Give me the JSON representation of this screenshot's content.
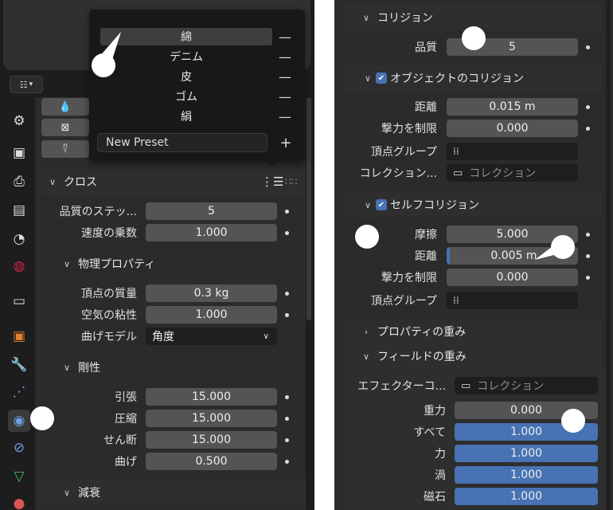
{
  "popup": {
    "presets": [
      "綿",
      "デニム",
      "皮",
      "ゴム",
      "絹"
    ],
    "remove_icon": "minus-icon",
    "new_preset_placeholder": "New Preset",
    "add_icon": "plus-icon"
  },
  "left": {
    "cloth_header": "クロス",
    "rows_top": [
      {
        "label": "品質のステッ...",
        "value": "5"
      },
      {
        "label": "速度の乗数",
        "value": "1.000"
      }
    ],
    "physics_header": "物理プロパティ",
    "physics_rows": [
      {
        "label": "頂点の質量",
        "value": "0.3 kg"
      },
      {
        "label": "空気の粘性",
        "value": "1.000"
      }
    ],
    "bend_model_label": "曲げモデル",
    "bend_model_value": "角度",
    "stiffness_header": "剛性",
    "stiffness_rows": [
      {
        "label": "引張",
        "value": "15.000"
      },
      {
        "label": "圧縮",
        "value": "15.000"
      },
      {
        "label": "せん断",
        "value": "15.000"
      },
      {
        "label": "曲げ",
        "value": "0.500"
      }
    ],
    "damping_header": "減衰"
  },
  "right": {
    "collision_header": "コリジョン",
    "quality_label": "品質",
    "quality_value": "5",
    "object_collision_header": "オブジェクトのコリジョン",
    "object_rows": [
      {
        "label": "距離",
        "value": "0.015 m"
      },
      {
        "label": "撃力を制限",
        "value": "0.000"
      }
    ],
    "vertex_group_label": "頂点グループ",
    "collection_label": "コレクション...",
    "collection_placeholder": "コレクション",
    "self_collision_header": "セルフコリジョン",
    "self_rows": [
      {
        "label": "摩擦",
        "value": "5.000"
      },
      {
        "label": "距離",
        "value": "0.005 m"
      },
      {
        "label": "撃力を制限",
        "value": "0.000"
      }
    ],
    "self_vertex_group_label": "頂点グループ",
    "property_weights_header": "プロパティの重み",
    "field_weights_header": "フィールドの重み",
    "effector_label": "エフェクターコ...",
    "effector_placeholder": "コレクション",
    "field_rows": [
      {
        "label": "重力",
        "value": "0.000"
      },
      {
        "label": "すべて",
        "value": "1.000"
      },
      {
        "label": "力",
        "value": "1.000"
      },
      {
        "label": "渦",
        "value": "1.000"
      },
      {
        "label": "磁石",
        "value": "1.000"
      }
    ]
  },
  "colors": {
    "accent": "#4772b3",
    "field": "#545454",
    "panel": "#2b2b2b"
  }
}
